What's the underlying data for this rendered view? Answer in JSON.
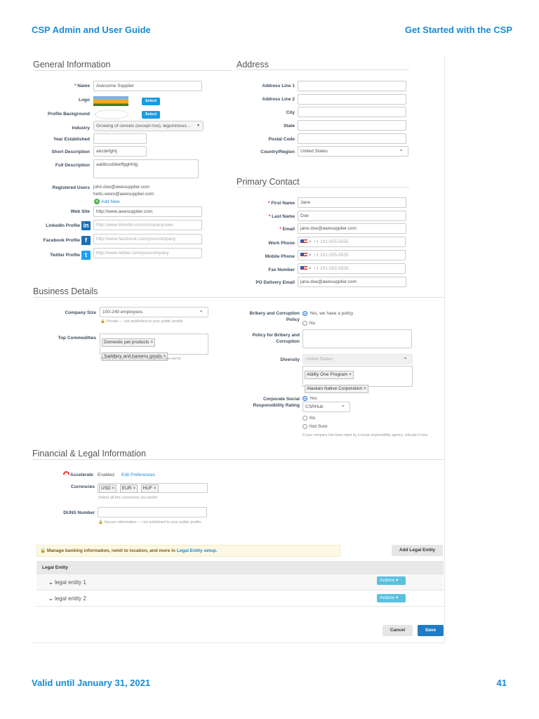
{
  "header": {
    "left": "CSP Admin and User Guide",
    "right": "Get Started with the CSP"
  },
  "footer": {
    "left": "Valid until January 31, 2021",
    "page": "41"
  },
  "general": {
    "title": "General Information",
    "name_label": "Name",
    "name_value": "Awesome Supplier",
    "logo_label": "Logo",
    "select": "Select",
    "bg_label": "Profile Background",
    "industry_label": "Industry",
    "industry_value": "Growing of cereals (except rice), leguminous...",
    "year_label": "Year Established",
    "year_value": "",
    "short_label": "Short Description",
    "short_value": "abcdefghij",
    "full_label": "Full Description",
    "full_value": "aabbccddeeffgghhiijj",
    "users_label": "Registered Users",
    "users": [
      "john.doe@awesupplier.com",
      "hello.ween@awesupplier.com"
    ],
    "add_new": "Add New",
    "web_label": "Web Site",
    "web_value": "http://www.awesupplier.com",
    "linkedin_label": "LinkedIn Profile",
    "linkedin_ph": "http://www.linkedin.com/company/awe",
    "facebook_label": "Facebook Profile",
    "facebook_ph": "http://www.facebook.com/yourcompany",
    "twitter_label": "Twitter Profile",
    "twitter_ph": "http://www.twitter.com/yourcompany"
  },
  "address": {
    "title": "Address",
    "line1": "Address Line 1",
    "line2": "Address Line 2",
    "city": "City",
    "state": "State",
    "postal": "Postal Code",
    "country_label": "Country/Region",
    "country_value": "United States"
  },
  "contact": {
    "title": "Primary Contact",
    "first_label": "First Name",
    "first_value": "Jane",
    "last_label": "Last Name",
    "last_value": "Doe",
    "email_label": "Email",
    "email_value": "jane.doe@awesupplier.com",
    "work_label": "Work Phone",
    "mobile_label": "Mobile Phone",
    "fax_label": "Fax Number",
    "phone_ph": "+1 201-555-5555",
    "po_label": "PO Delivery Email",
    "po_value": "jane.doe@awesupplier.com"
  },
  "business": {
    "title": "Business Details",
    "size_label": "Company Size",
    "size_value": "100-249 employees",
    "private_note": "Private — not published to your public profile",
    "commodities_label": "Top Commodities",
    "commodities": [
      "Domestic pet products",
      "Saddlery and harness goods"
    ],
    "commodities_note": "Select the top 5 UNSPSC categories you serve",
    "bribery_label": "Bribery and Corruption Policy",
    "bribery_yes": "Yes, we have a policy",
    "bribery_no": "No",
    "policy_label": "Policy for Bribery and Corruption",
    "diversity_label": "Diversity",
    "diversity_value": "United States",
    "diversity_tags": [
      "Ability One Program",
      "Alaskan Native Corporation"
    ],
    "csr_label": "Corporate Social Responsibility Rating",
    "csr_yes": "Yes",
    "csr_value": "CSRHub",
    "csr_no": "No",
    "csr_notsure": "Not Sure",
    "csr_note": "If your company has been rated by a social responsibility agency, indicate it here."
  },
  "financial": {
    "title": "Financial & Legal Information",
    "accelerate_label": "Accelerate",
    "accelerate_status": "Enabled",
    "edit_prefs": "Edit Preferences",
    "currencies_label": "Currencies",
    "currencies": [
      "USD",
      "EUR",
      "HUF"
    ],
    "currencies_note": "Select all the currencies you prefer",
    "duns_label": "DUNS Number",
    "secure_note": "Secure information — not published to your public profile",
    "banner_text": "Manage banking information, remit to location, and more in",
    "banner_link": "Legal Entity setup.",
    "add_entity": "Add Legal Entity",
    "table_header": "Legal Entity",
    "entities": [
      "legal entity 1",
      "legal entity 2"
    ],
    "actions": "Actions",
    "cancel": "Cancel",
    "save": "Save"
  }
}
